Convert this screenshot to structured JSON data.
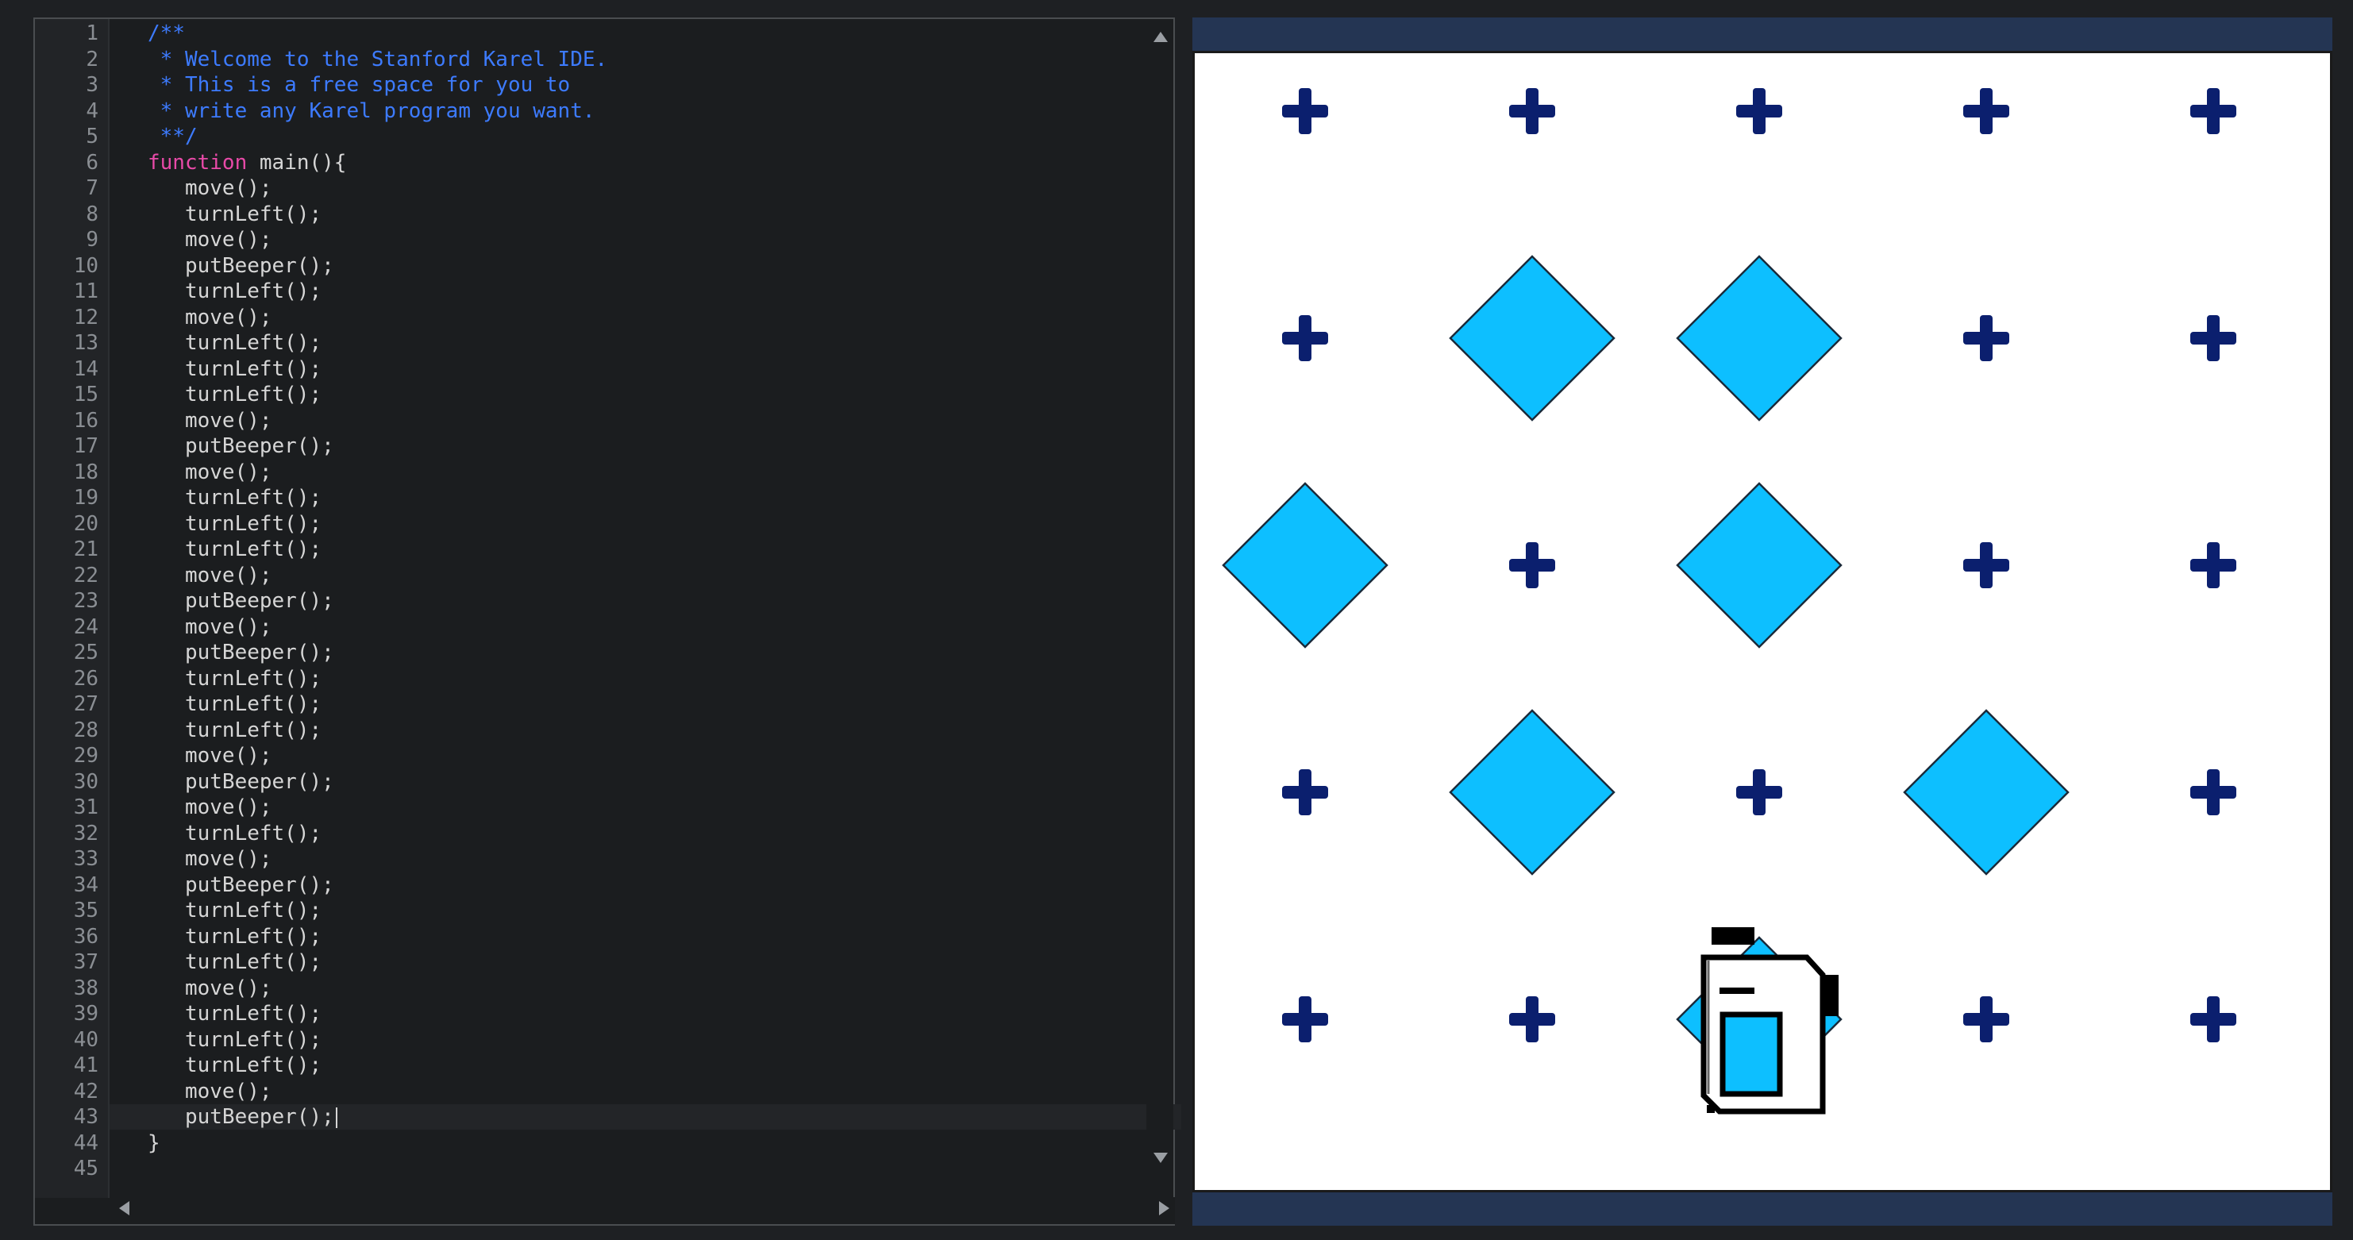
{
  "editor": {
    "lines": [
      {
        "n": "1",
        "text": "/**",
        "type": "comment"
      },
      {
        "n": "2",
        "text": " * Welcome to the Stanford Karel IDE.",
        "type": "comment"
      },
      {
        "n": "3",
        "text": " * This is a free space for you to",
        "type": "comment"
      },
      {
        "n": "4",
        "text": " * write any Karel program you want.",
        "type": "comment"
      },
      {
        "n": "5",
        "text": " **/",
        "type": "comment"
      },
      {
        "n": "6",
        "text": "function main(){",
        "type": "function"
      },
      {
        "n": "7",
        "text": "   move();",
        "type": "code"
      },
      {
        "n": "8",
        "text": "   turnLeft();",
        "type": "code"
      },
      {
        "n": "9",
        "text": "   move();",
        "type": "code"
      },
      {
        "n": "10",
        "text": "   putBeeper();",
        "type": "code"
      },
      {
        "n": "11",
        "text": "   turnLeft();",
        "type": "code"
      },
      {
        "n": "12",
        "text": "   move();",
        "type": "code"
      },
      {
        "n": "13",
        "text": "   turnLeft();",
        "type": "code"
      },
      {
        "n": "14",
        "text": "   turnLeft();",
        "type": "code"
      },
      {
        "n": "15",
        "text": "   turnLeft();",
        "type": "code"
      },
      {
        "n": "16",
        "text": "   move();",
        "type": "code"
      },
      {
        "n": "17",
        "text": "   putBeeper();",
        "type": "code"
      },
      {
        "n": "18",
        "text": "   move();",
        "type": "code"
      },
      {
        "n": "19",
        "text": "   turnLeft();",
        "type": "code"
      },
      {
        "n": "20",
        "text": "   turnLeft();",
        "type": "code"
      },
      {
        "n": "21",
        "text": "   turnLeft();",
        "type": "code"
      },
      {
        "n": "22",
        "text": "   move();",
        "type": "code"
      },
      {
        "n": "23",
        "text": "   putBeeper();",
        "type": "code"
      },
      {
        "n": "24",
        "text": "   move();",
        "type": "code"
      },
      {
        "n": "25",
        "text": "   putBeeper();",
        "type": "code"
      },
      {
        "n": "26",
        "text": "   turnLeft();",
        "type": "code"
      },
      {
        "n": "27",
        "text": "   turnLeft();",
        "type": "code"
      },
      {
        "n": "28",
        "text": "   turnLeft();",
        "type": "code"
      },
      {
        "n": "29",
        "text": "   move();",
        "type": "code"
      },
      {
        "n": "30",
        "text": "   putBeeper();",
        "type": "code"
      },
      {
        "n": "31",
        "text": "   move();",
        "type": "code"
      },
      {
        "n": "32",
        "text": "   turnLeft();",
        "type": "code"
      },
      {
        "n": "33",
        "text": "   move();",
        "type": "code"
      },
      {
        "n": "34",
        "text": "   putBeeper();",
        "type": "code"
      },
      {
        "n": "35",
        "text": "   turnLeft();",
        "type": "code"
      },
      {
        "n": "36",
        "text": "   turnLeft();",
        "type": "code"
      },
      {
        "n": "37",
        "text": "   turnLeft();",
        "type": "code"
      },
      {
        "n": "38",
        "text": "   move();",
        "type": "code"
      },
      {
        "n": "39",
        "text": "   turnLeft();",
        "type": "code"
      },
      {
        "n": "40",
        "text": "   turnLeft();",
        "type": "code"
      },
      {
        "n": "41",
        "text": "   turnLeft();",
        "type": "code"
      },
      {
        "n": "42",
        "text": "   move();",
        "type": "code"
      },
      {
        "n": "43",
        "text": "   putBeeper();",
        "type": "code"
      },
      {
        "n": "44",
        "text": "}",
        "type": "code"
      },
      {
        "n": "45",
        "text": "",
        "type": "code"
      }
    ],
    "active_line": 43,
    "colors": {
      "comment": "#3d7bff",
      "keyword": "#e84aa8",
      "text": "#d6d6d6"
    }
  },
  "world": {
    "columns": 5,
    "rows": 5,
    "beepers": [
      [
        2,
        2
      ],
      [
        3,
        2
      ],
      [
        1,
        3
      ],
      [
        3,
        3
      ],
      [
        2,
        4
      ],
      [
        4,
        4
      ],
      [
        3,
        5
      ]
    ],
    "karel": {
      "col": 3,
      "row": 5,
      "facing": "east"
    },
    "colors": {
      "beeper": "#0dbfff",
      "corner": "#0b1f6e",
      "bar": "#243553"
    }
  }
}
